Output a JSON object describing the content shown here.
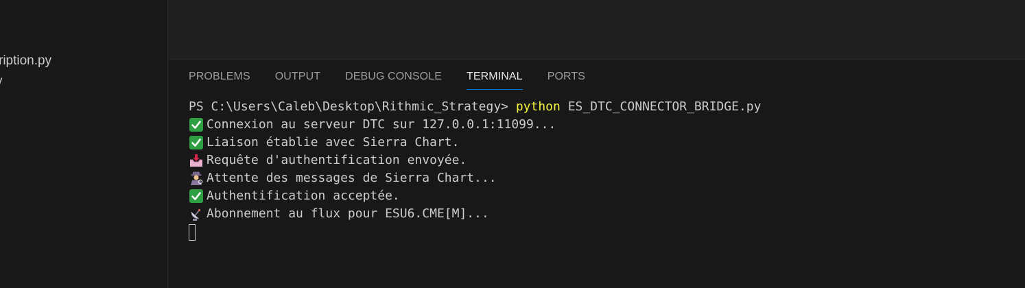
{
  "sidebar": {
    "items": [
      {
        "label": "ription.py"
      },
      {
        "label": "y"
      }
    ]
  },
  "panel": {
    "tabs": [
      {
        "label": "PROBLEMS",
        "active": false
      },
      {
        "label": "OUTPUT",
        "active": false
      },
      {
        "label": "DEBUG CONSOLE",
        "active": false
      },
      {
        "label": "TERMINAL",
        "active": true
      },
      {
        "label": "PORTS",
        "active": false
      }
    ]
  },
  "terminal": {
    "prompt": "PS C:\\Users\\Caleb\\Desktop\\Rithmic_Strategy> ",
    "command": "python",
    "args": " ES_DTC_CONNECTOR_BRIDGE.py",
    "lines": [
      {
        "icon": "check-mark-icon",
        "text": "Connexion au serveur DTC sur 127.0.0.1:11099..."
      },
      {
        "icon": "check-mark-icon",
        "text": "Liaison établie avec Sierra Chart."
      },
      {
        "icon": "inbox-tray-icon",
        "text": "Requête d'authentification envoyée."
      },
      {
        "icon": "detective-icon",
        "text": "Attente des messages de Sierra Chart..."
      },
      {
        "icon": "check-mark-icon",
        "text": "Authentification acceptée."
      },
      {
        "icon": "satellite-antenna-icon",
        "text": "Abonnement au flux pour ESU6.CME[M]..."
      }
    ]
  },
  "colors": {
    "background": "#1f1f1f",
    "panel": "#181818",
    "command": "#f5f543",
    "accent": "#0078d4",
    "check": "#2ea043"
  }
}
